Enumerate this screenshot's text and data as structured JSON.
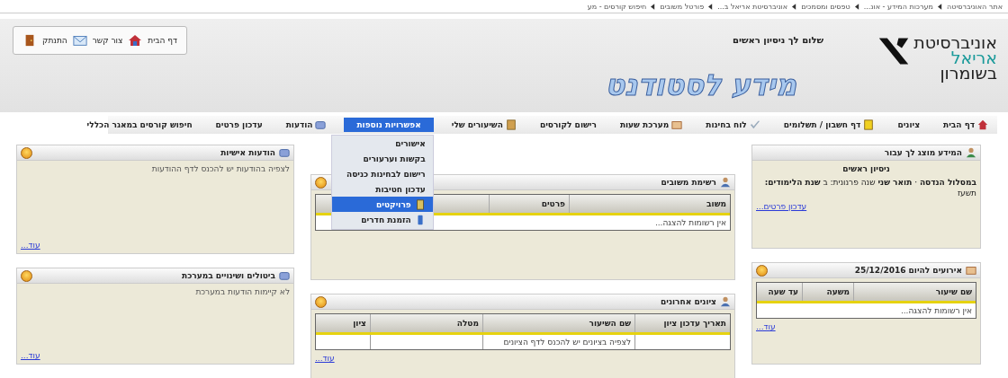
{
  "breadcrumbs": [
    "אתר האוניברסיטה",
    "מערכות המידע - אונ...",
    "טפסים ומסמכים",
    "אוניברסיטת אריאל ב...",
    "פורטל משובים",
    "חיפוש קורסים - מע"
  ],
  "header": {
    "links": [
      {
        "label": "דף הבית"
      },
      {
        "label": "צור קשר"
      },
      {
        "label": "התנתק"
      }
    ],
    "greeting": "שלום לך ניסיון ראשים",
    "logo": [
      "אוניברסיטת",
      "אריאל",
      "בשומרון"
    ],
    "site_title": "מידע לסטודנט"
  },
  "nav": [
    {
      "label": "דף הבית",
      "selected": false
    },
    {
      "label": "ציונים",
      "selected": false
    },
    {
      "label": "דף חשבון / תשלומים",
      "selected": false
    },
    {
      "label": "לוח בחינות",
      "selected": false
    },
    {
      "label": "מערכת שעות",
      "selected": false
    },
    {
      "label": "רישום לקורסים",
      "selected": false
    },
    {
      "label": "השיעורים שלי",
      "selected": false
    },
    {
      "label": "אפשרויות נוספות",
      "selected": true
    },
    {
      "label": "הודעות",
      "selected": false
    },
    {
      "label": "עדכון פרטים",
      "selected": false
    },
    {
      "label": "חיפוש קורסים במאגר הכללי",
      "selected": false
    }
  ],
  "dropdown": [
    {
      "label": "אישורים",
      "selected": false
    },
    {
      "label": "בקשות וערעורים",
      "selected": false
    },
    {
      "label": "רישום לבחינות כניסה",
      "selected": false
    },
    {
      "label": "עדכון חטיבות",
      "selected": false
    },
    {
      "label": "פרויקטים",
      "selected": true
    },
    {
      "label": "הזמנת חדרים",
      "selected": false
    }
  ],
  "student_panel": {
    "title": "המידע מוצג לך עבור",
    "name": "ניסיון ראשים",
    "details": "**במסלול הנדסה** · **תואר שני** שנה פרנונית: ב **שנת הלימודים:** תשעז",
    "link": "עדכון פרטים..."
  },
  "events_panel": {
    "title": "אירועים להיום 25/12/2016",
    "columns": [
      "שם שיעור",
      "משעה",
      "עד שעה"
    ],
    "empty": "אין רשומות להצגה...",
    "more": "עוד..."
  },
  "feedback_panel": {
    "title": "רשימת משובים",
    "columns": [
      "משוב",
      "פרטים"
    ],
    "empty": "אין רשומות להצגה..."
  },
  "grades_panel": {
    "title": "ציונים אחרונים",
    "columns": [
      "תאריך עדכון ציון",
      "שם השיעור",
      "מטלה",
      "ציון"
    ],
    "rows": [
      [
        "",
        "לצפיה בציונים יש להכנס לדף הציונים",
        "",
        ""
      ]
    ],
    "more": "עוד..."
  },
  "messages_panel": {
    "title": "הודעות אישיות",
    "text": "לצפיה בהודעות יש להכנס לדף ההודעות",
    "more": "עוד..."
  },
  "changes_panel": {
    "title": "ביטולים ושינויים במערכת",
    "text": "לא קיימות הודעות במערכת",
    "more": "עוד..."
  }
}
